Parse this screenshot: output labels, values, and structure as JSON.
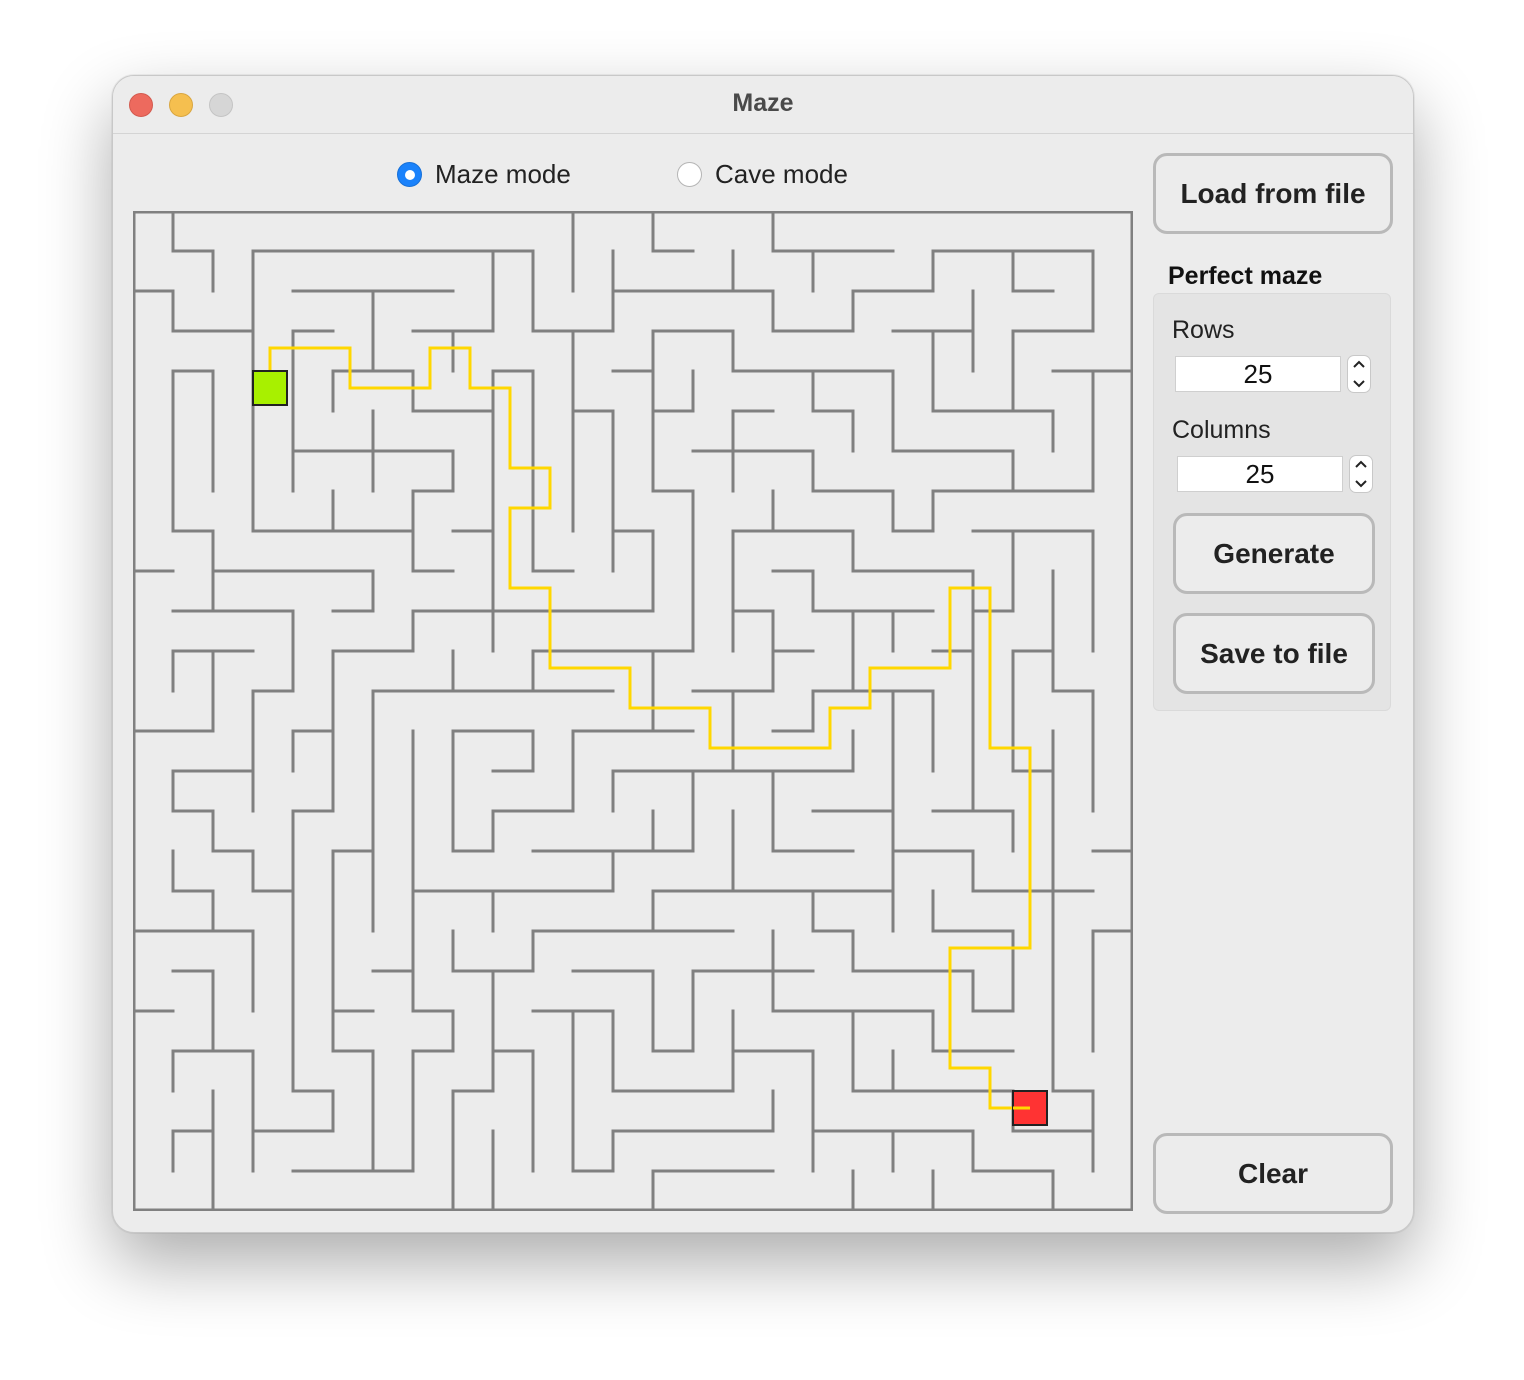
{
  "window": {
    "title": "Maze"
  },
  "modes": {
    "maze_label": "Maze mode",
    "cave_label": "Cave mode",
    "selected": "maze"
  },
  "sidebar": {
    "load_label": "Load from file",
    "section_title": "Perfect maze",
    "rows_label": "Rows",
    "rows_value": "25",
    "columns_label": "Columns",
    "columns_value": "25",
    "generate_label": "Generate",
    "save_label": "Save to file",
    "clear_label": "Clear"
  },
  "maze": {
    "rows": 25,
    "columns": 25,
    "start_cell": {
      "row": 4,
      "col": 3
    },
    "end_cell": {
      "row": 22,
      "col": 22
    },
    "colors": {
      "wall": "#808080",
      "path": "#ffd700",
      "start": "#a8f000",
      "end": "#ff3333",
      "background": "#ececec"
    }
  }
}
